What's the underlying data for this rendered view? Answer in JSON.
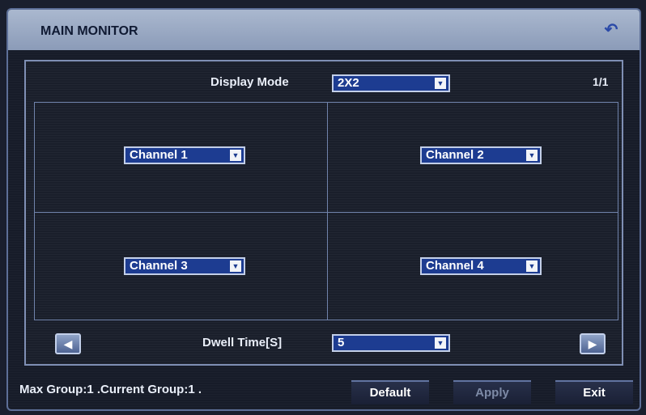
{
  "window": {
    "title": "MAIN MONITOR",
    "back_icon": "return-arrow-icon"
  },
  "display_mode": {
    "label": "Display Mode",
    "value": "2X2"
  },
  "page_indicator": "1/1",
  "channels": [
    {
      "value": "Channel 1"
    },
    {
      "value": "Channel 2"
    },
    {
      "value": "Channel 3"
    },
    {
      "value": "Channel 4"
    }
  ],
  "dwell_time": {
    "label": "Dwell Time[S]",
    "value": "5"
  },
  "nav": {
    "prev_icon": "triangle-left-icon",
    "next_icon": "triangle-right-icon"
  },
  "status_text": "Max Group:1 .Current Group:1 .",
  "buttons": {
    "default": "Default",
    "apply": "Apply",
    "exit": "Exit"
  },
  "colors": {
    "dropdown_bg": "#1d3c91",
    "title_bar": "#aab8cf",
    "panel_border": "#7f8fb4"
  }
}
